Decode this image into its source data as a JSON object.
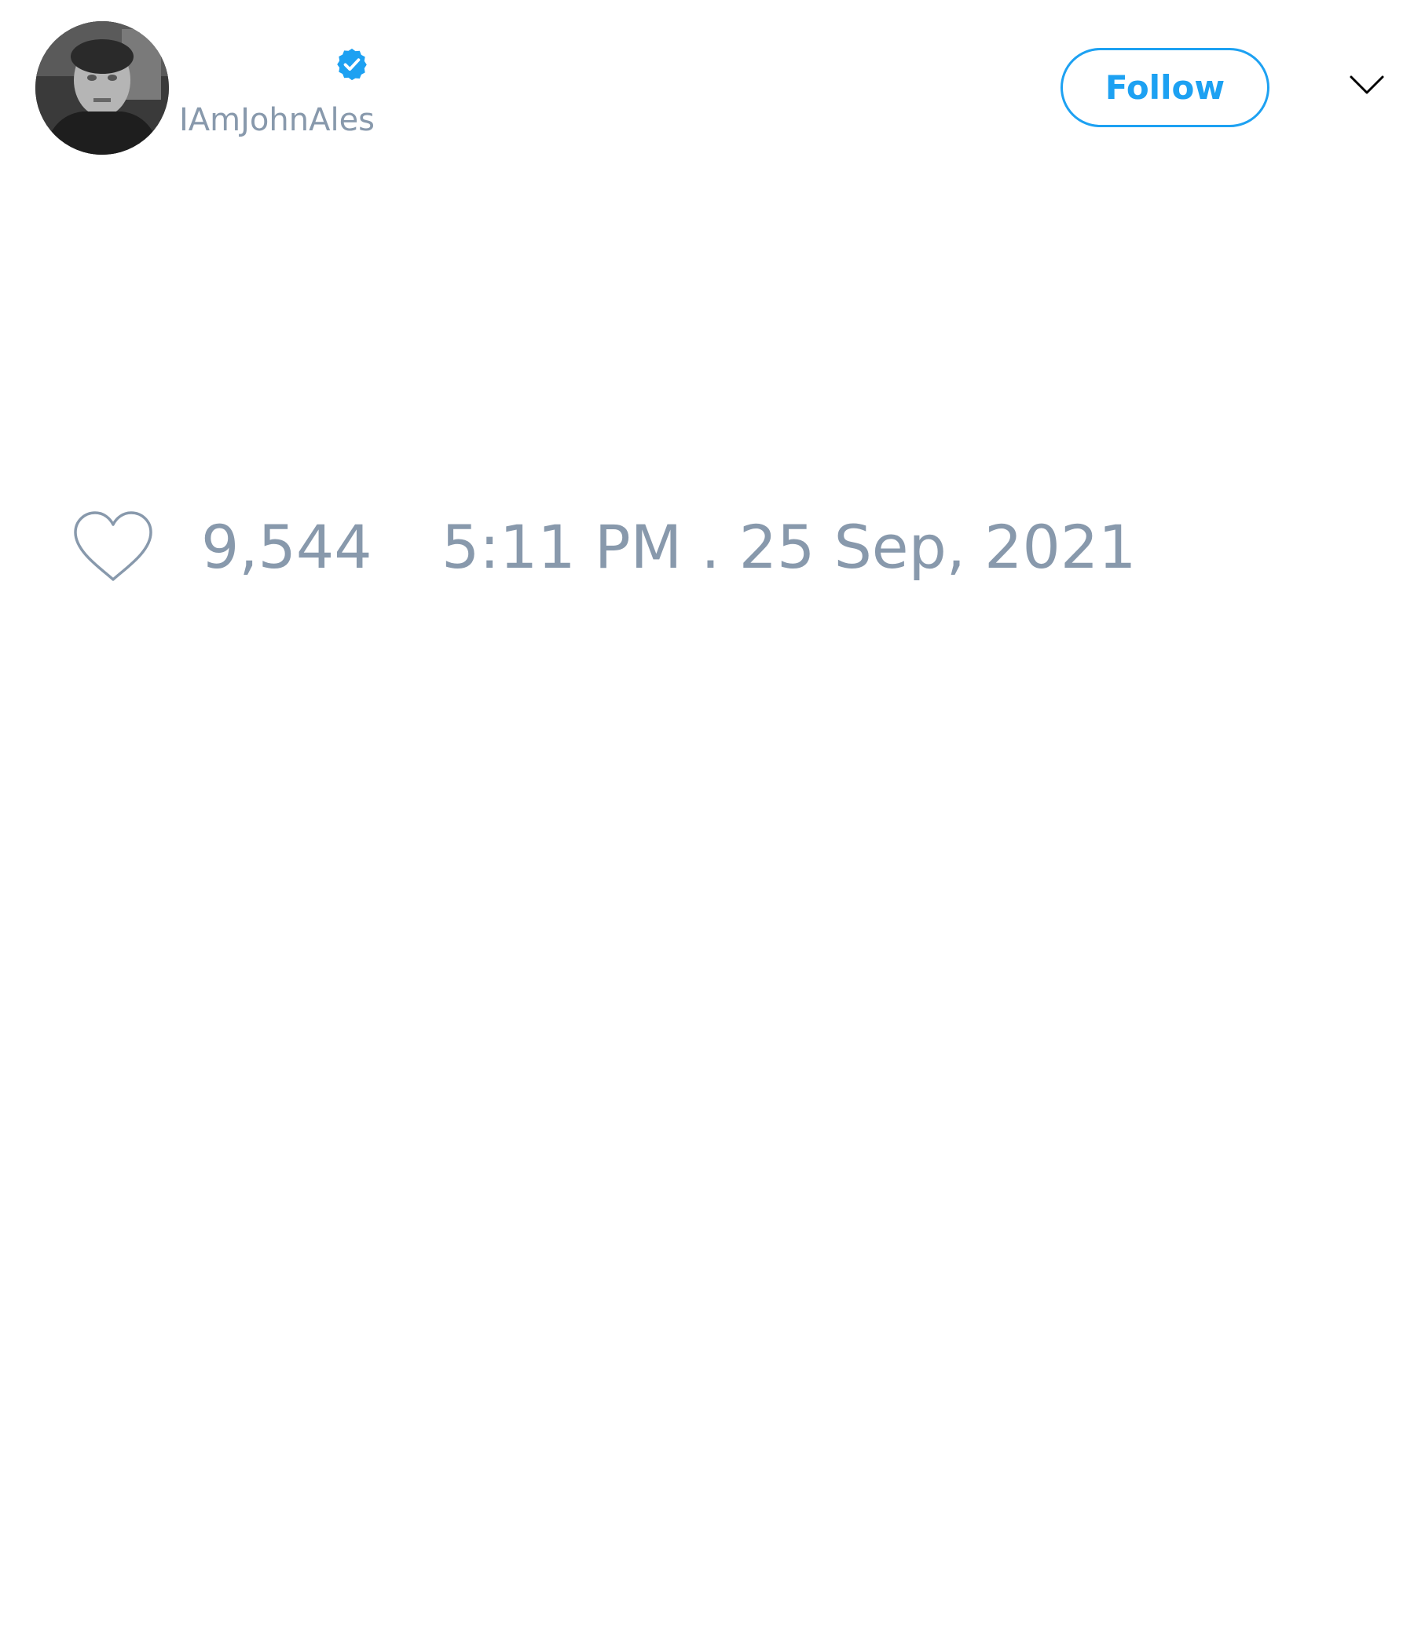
{
  "tweet": {
    "author": {
      "handle": "IAmJohnAles",
      "verified": true,
      "avatar_icon": "profile-photo"
    },
    "follow_label": "Follow",
    "menu_icon": "chevron-down-icon",
    "like_icon": "heart-icon",
    "likes": "9,544",
    "timestamp": "5:11 PM . 25 Sep, 2021"
  },
  "colors": {
    "accent": "#1da1f2",
    "muted_text": "#8899ac",
    "background": "#ffffff"
  }
}
